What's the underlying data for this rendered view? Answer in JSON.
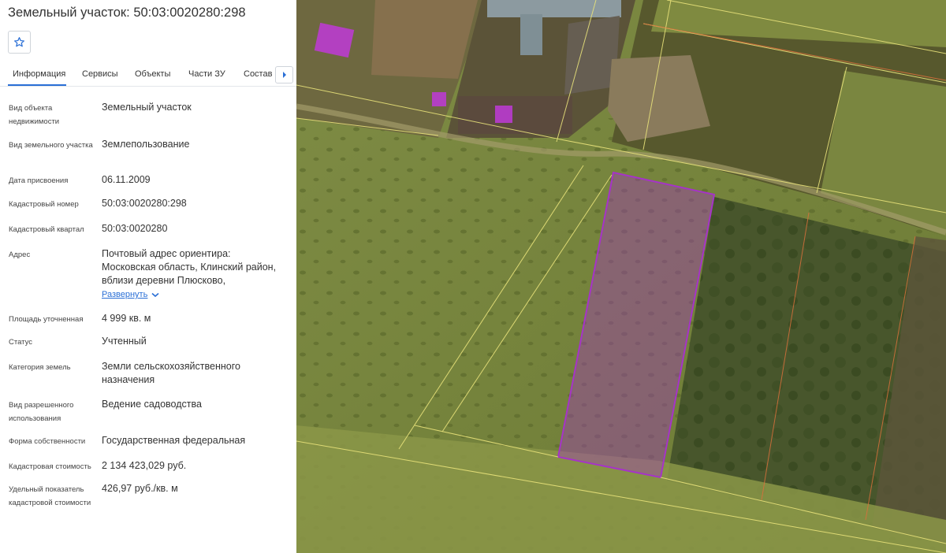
{
  "panel": {
    "title": "Земельный участок: 50:03:0020280:298",
    "favorite_icon": "star-outline-icon",
    "tabs": [
      {
        "label": "Информация",
        "active": true
      },
      {
        "label": "Сервисы",
        "active": false
      },
      {
        "label": "Объекты",
        "active": false
      },
      {
        "label": "Части ЗУ",
        "active": false
      },
      {
        "label": "Состав ЕЗП",
        "active": false
      }
    ],
    "tabs_next_icon": "chevron-right-icon",
    "accent": "#2a6fd6",
    "rows": [
      {
        "label": "Вид объекта недвижимости",
        "value": "Земельный участок"
      },
      {
        "label": "Вид земельного участка",
        "value": "Землепользование"
      },
      {
        "label": "Дата присвоения",
        "value": "06.11.2009"
      },
      {
        "label": "Кадастровый номер",
        "value": "50:03:0020280:298"
      },
      {
        "label": "Кадастровый квартал",
        "value": "50:03:0020280"
      },
      {
        "label": "Адрес",
        "value": "Почтовый адрес ориентира: Московская область, Клинский район, вблизи деревни Плюсково,"
      },
      {
        "label": "Площадь уточненная",
        "value": "4 999 кв. м"
      },
      {
        "label": "Статус",
        "value": "Учтенный"
      },
      {
        "label": "Категория земель",
        "value": "Земли сельскохозяйственного назначения"
      },
      {
        "label": "Вид разрешенного использования",
        "value": "Ведение садоводства"
      },
      {
        "label": "Форма собственности",
        "value": "Государственная федеральная"
      },
      {
        "label": "Кадастровая стоимость",
        "value": "2 134 423,029 руб."
      },
      {
        "label": "Удельный показатель кадастровой стоимости",
        "value": "426,97 руб./кв. м"
      }
    ],
    "expand_label": "Развернуть",
    "expand_icon": "chevron-down-icon"
  },
  "map": {
    "selected_parcel_color": "#a633c8",
    "boundary_color": "#e8e27a",
    "building_highlight_color": "#c03ad8"
  }
}
